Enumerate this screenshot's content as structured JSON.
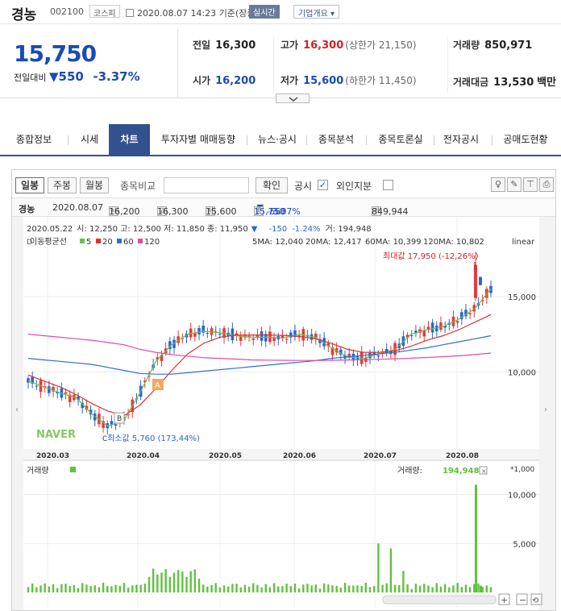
{
  "header": {
    "name": "경농",
    "code": "002100",
    "market": "코스피",
    "datetime": "2020.08.07 14:23",
    "basis": "기준(장중)",
    "live_badge": "실시간",
    "company_info": "기업개요"
  },
  "quote": {
    "price": "15,750",
    "change_label": "전일대비",
    "change_amount": "550",
    "change_pct": "-3.37%",
    "prev_close_label": "전일",
    "prev_close": "16,300",
    "high_label": "고가",
    "high": "16,300",
    "upper_limit": "(상한가 21,150)",
    "volume_label": "거래량",
    "volume": "850,971",
    "open_label": "시가",
    "open": "16,200",
    "low_label": "저가",
    "low": "15,600",
    "lower_limit": "(하한가 11,450)",
    "value_label": "거래대금",
    "value": "13,530",
    "value_unit": "백만"
  },
  "tabs": [
    "종합정보",
    "시세",
    "차트",
    "투자자별 매매동향",
    "뉴스·공시",
    "종목분석",
    "종목토론실",
    "전자공시",
    "공매도현황"
  ],
  "toolbar": {
    "daily": "일봉",
    "weekly": "주봉",
    "monthly": "월봉",
    "compare_label": "종목비교",
    "confirm": "확인",
    "disclosure": "공시",
    "foreign": "외인지분"
  },
  "summary": {
    "name": "경농",
    "date": "2020.08.07",
    "open": "16,200",
    "high": "16,300",
    "low": "15,600",
    "close": "15,750",
    "change": "-550",
    "pct": "-3.37%",
    "volume": "849,944"
  },
  "chart": {
    "info_date": "2020.05.22",
    "info_text": "시: 12,250  고: 12,500  저: 11,850  종: 11,950",
    "info_chg": "-150",
    "info_pct": "-1.24%",
    "info_vol": "거: 194,948",
    "ma_legend_title": "이동평균선",
    "ma_legend": [
      "5",
      "20",
      "60",
      "120"
    ],
    "ma_values": [
      "5MA: 12,040",
      "20MA: 12,417",
      "60MA: 10,399",
      "120MA: 10,802"
    ],
    "scale": "linear",
    "max_label": "최대값 17,950 (-12,26%)",
    "min_label": "최소값 5,760 (173,44%)",
    "marker_a": "A",
    "marker_b": "B",
    "marker_c": "C",
    "marker_d": "D",
    "watermark": "NAVER",
    "volume_title": "거래량",
    "volume_now_label": "거래량:",
    "volume_now": "194,948",
    "volume_unit": "*1,000",
    "colors": {
      "up": "#e83a3a",
      "down": "#2a66d4",
      "ma5": "#6cc04a",
      "ma20": "#e03030",
      "ma60": "#2f6fd6",
      "ma120": "#e24ba8",
      "vol": "#5fc23d"
    }
  },
  "chart_data": {
    "type": "candlestick",
    "x_ticks": [
      "2020.03",
      "2020.04",
      "2020.05",
      "2020.06",
      "2020.07",
      "2020.08"
    ],
    "y_ticks": [
      "15,000",
      "10,000"
    ],
    "y_range": [
      5000,
      19000
    ],
    "volume_ticks": [
      "10,000",
      "5,000"
    ],
    "volume_range": [
      0,
      11200
    ],
    "series": [
      {
        "name": "5",
        "values": [
          9400,
          9000,
          8600,
          8300,
          7200,
          6400,
          6800,
          8600,
          10700,
          11800,
          12500,
          12700,
          12600,
          12400,
          12300,
          12300,
          12250,
          12500,
          12300,
          11600,
          11000,
          10900,
          11200,
          11500,
          12500,
          12800,
          13000,
          13500,
          14200,
          15500
        ]
      },
      {
        "name": "20",
        "values": [
          9800,
          9400,
          9000,
          8500,
          7900,
          7400,
          7100,
          7800,
          8900,
          10100,
          11200,
          11900,
          12300,
          12450,
          12450,
          12450,
          12420,
          12350,
          12200,
          11900,
          11500,
          11300,
          11300,
          11400,
          11700,
          12100,
          12400,
          12800,
          13300,
          13800
        ]
      },
      {
        "name": "60",
        "values": [
          10900,
          10800,
          10700,
          10600,
          10500,
          10300,
          10100,
          9900,
          9850,
          9850,
          9950,
          10050,
          10150,
          10250,
          10350,
          10450,
          10550,
          10650,
          10750,
          10900,
          11000,
          11100,
          11200,
          11300,
          11450,
          11600,
          11800,
          12000,
          12200,
          12400
        ]
      },
      {
        "name": "120",
        "values": [
          12500,
          12400,
          12300,
          12200,
          12100,
          11950,
          11800,
          11500,
          11300,
          11150,
          11050,
          10950,
          10900,
          10850,
          10800,
          10780,
          10770,
          10760,
          10760,
          10770,
          10790,
          10810,
          10840,
          10870,
          10910,
          10960,
          11010,
          11070,
          11150,
          11250
        ]
      }
    ],
    "max": 17950,
    "min": 5760
  }
}
